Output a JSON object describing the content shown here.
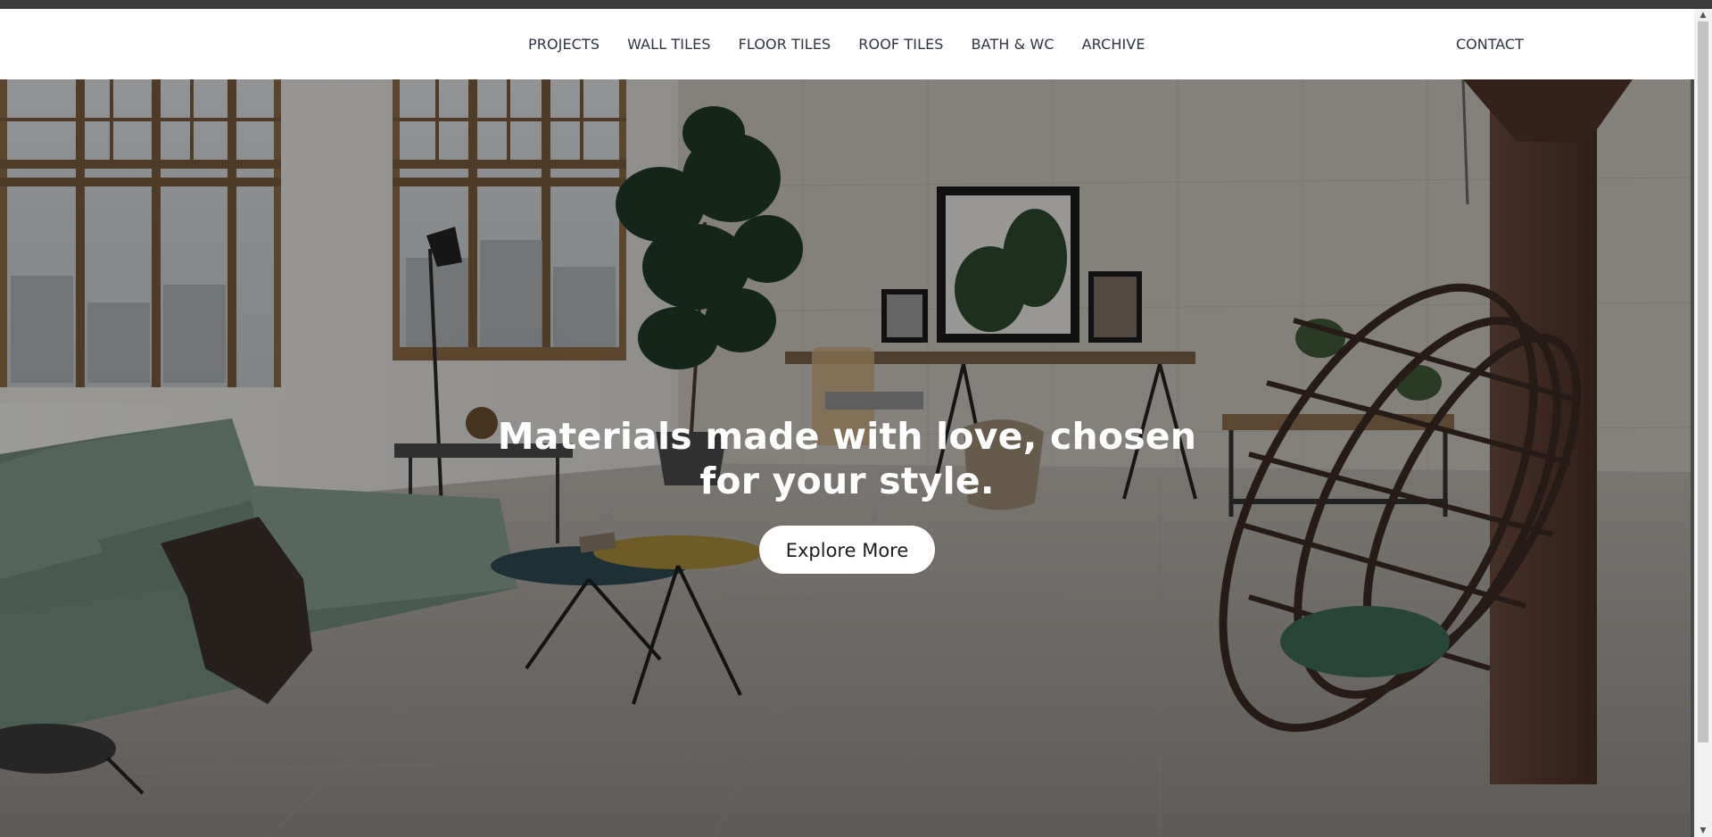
{
  "nav": {
    "items": [
      {
        "label": "PROJECTS"
      },
      {
        "label": "WALL TILES"
      },
      {
        "label": "FLOOR TILES"
      },
      {
        "label": "ROOF TILES"
      },
      {
        "label": "BATH & WC"
      },
      {
        "label": "ARCHIVE"
      }
    ],
    "contact": "CONTACT"
  },
  "hero": {
    "headline": "Materials made with love, chosen for your style.",
    "button_label": "Explore More",
    "image": "living-room-interior-photo"
  },
  "colors": {
    "nav_text": "#2f3442",
    "overlay": "rgba(0,0,0,0.34)",
    "button_bg": "#ffffff"
  },
  "scrollbar": {
    "up_icon": "scroll-up-arrow-icon",
    "down_icon": "scroll-down-arrow-icon"
  }
}
